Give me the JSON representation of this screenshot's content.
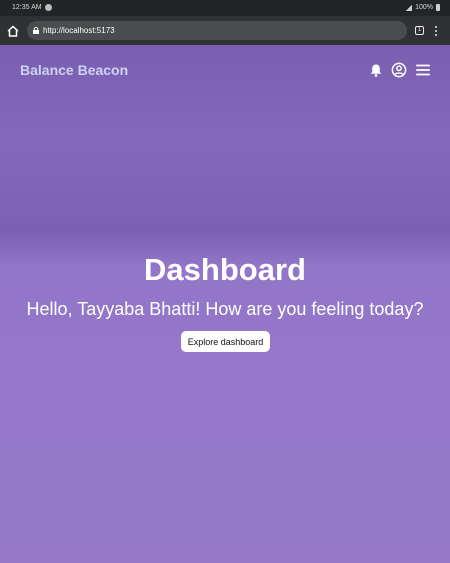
{
  "status_bar": {
    "time": "12:35 AM",
    "battery": "100%"
  },
  "browser": {
    "url": "http://localhost:5173",
    "tabs_count": "1"
  },
  "header": {
    "brand": "Balance Beacon"
  },
  "hero": {
    "title": "Dashboard",
    "subtitle": "Hello, Tayyaba Bhatti! How are you feeling today?",
    "button_label": "Explore dashboard"
  },
  "icons": [
    "home-icon",
    "lock-icon",
    "tabs-icon",
    "menu-dots-icon",
    "bell-icon",
    "profile-icon",
    "hamburger-icon"
  ]
}
